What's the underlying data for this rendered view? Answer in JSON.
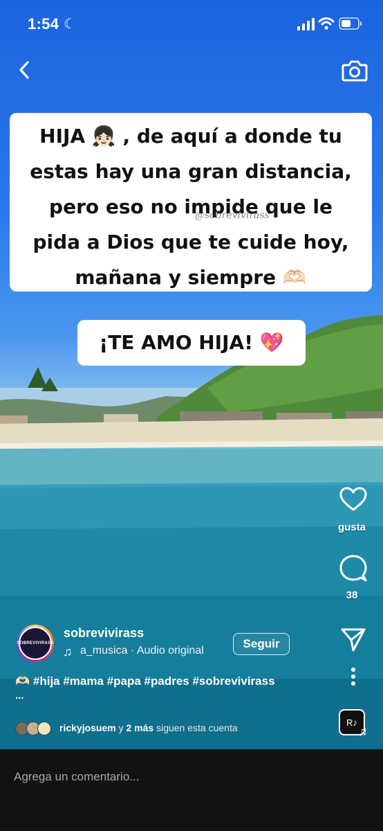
{
  "status_bar": {
    "time": "1:54",
    "moon": "☾"
  },
  "top_bar": {
    "back_icon": "chevron-left-icon",
    "camera_icon": "camera-icon"
  },
  "overlay": {
    "caption_lines": [
      "HIJA 👧🏻 , de aquí a donde tu",
      "estas hay una gran distancia,",
      "pero  eso  no impide que le",
      "pida a Dios que te cuide hoy,",
      "mañana y siempre 🫶🏻"
    ],
    "watermark": "@sobrevivirass",
    "banner": "¡TE AMO HIJA! 💖"
  },
  "actions": {
    "like_label": "gusta",
    "comment_count": "38"
  },
  "post": {
    "username": "sobrevivirass",
    "audio_icon": "♫",
    "audio": "a_musica · Audio original",
    "follow_label": "Seguir",
    "caption": "🫶🏻 #hija #mama #papa #padres #sobrevivirass",
    "caption_more": "...",
    "followers_name": "rickyjosuem",
    "followers_and": " y ",
    "followers_more": "2 más",
    "followers_suffix": " siguen esta cuenta",
    "music_thumb": "R♪",
    "music_note": "♫",
    "avatar_text": "SOBREVIVIRASS"
  },
  "comment": {
    "placeholder": "Agrega un comentario..."
  }
}
